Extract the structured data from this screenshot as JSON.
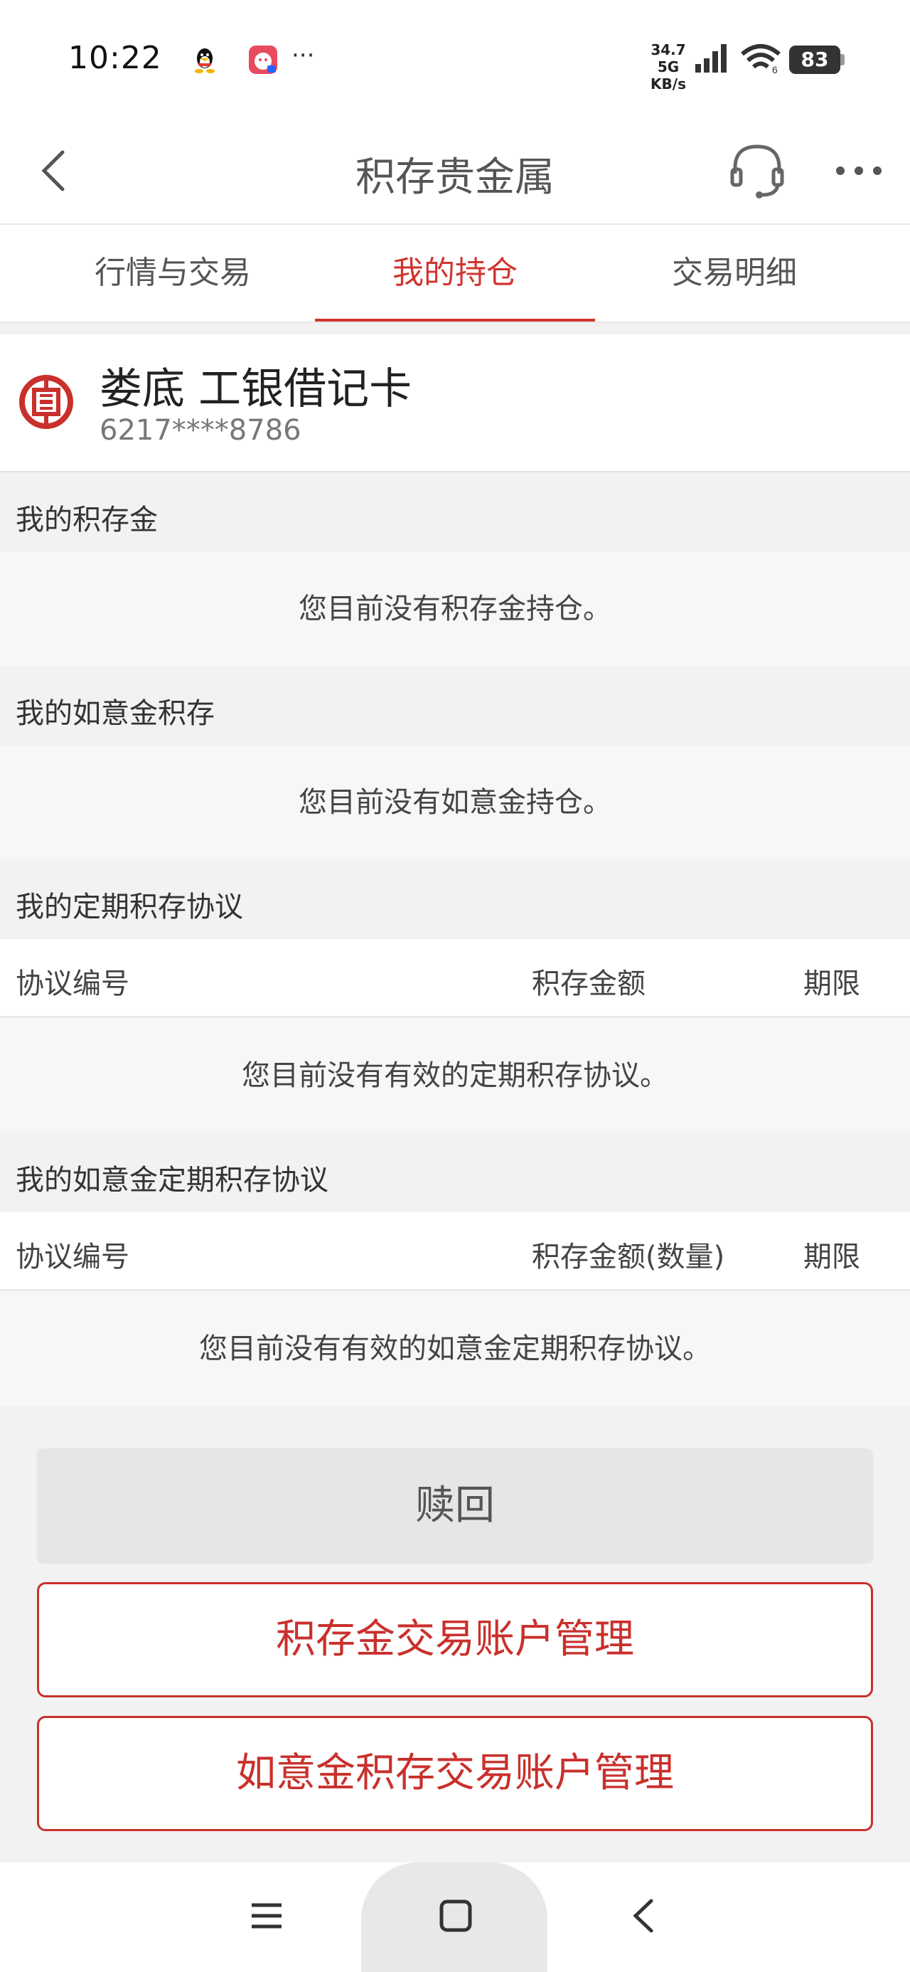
{
  "status_bar": {
    "time": "10:22",
    "net_speed_value": "34.7",
    "net_type": "5G",
    "net_speed_unit": "KB/s",
    "wifi_label": "6",
    "battery": "83",
    "more_notifications": "···"
  },
  "header": {
    "title": "积存贵金属",
    "back_icon": "chevron-left-icon",
    "service_icon": "headset-icon",
    "more_icon": "more-dots-icon"
  },
  "tabs": [
    {
      "label": "行情与交易",
      "active": false
    },
    {
      "label": "我的持仓",
      "active": true
    },
    {
      "label": "交易明细",
      "active": false
    }
  ],
  "account": {
    "bank_name": "娄底  工银借记卡",
    "card_number": "6217****8786"
  },
  "sections": {
    "gold_holdings": {
      "title": "我的积存金",
      "empty_text": "您目前没有积存金持仓。"
    },
    "ruyi_holdings": {
      "title": "我的如意金积存",
      "empty_text": "您目前没有如意金持仓。"
    },
    "fixed_agreements": {
      "title": "我的定期积存协议",
      "columns": [
        "协议编号",
        "积存金额",
        "期限"
      ],
      "empty_text": "您目前没有有效的定期积存协议。"
    },
    "ruyi_fixed_agreements": {
      "title": "我的如意金定期积存协议",
      "columns": [
        "协议编号",
        "积存金额(数量)",
        "期限"
      ],
      "empty_text": "您目前没有有效的如意金定期积存协议。"
    }
  },
  "buttons": {
    "redeem": "赎回",
    "gold_account_manage": "积存金交易账户管理",
    "ruyi_account_manage": "如意金积存交易账户管理"
  },
  "colors": {
    "accent": "#d0352f",
    "button_border": "#c9302c"
  }
}
